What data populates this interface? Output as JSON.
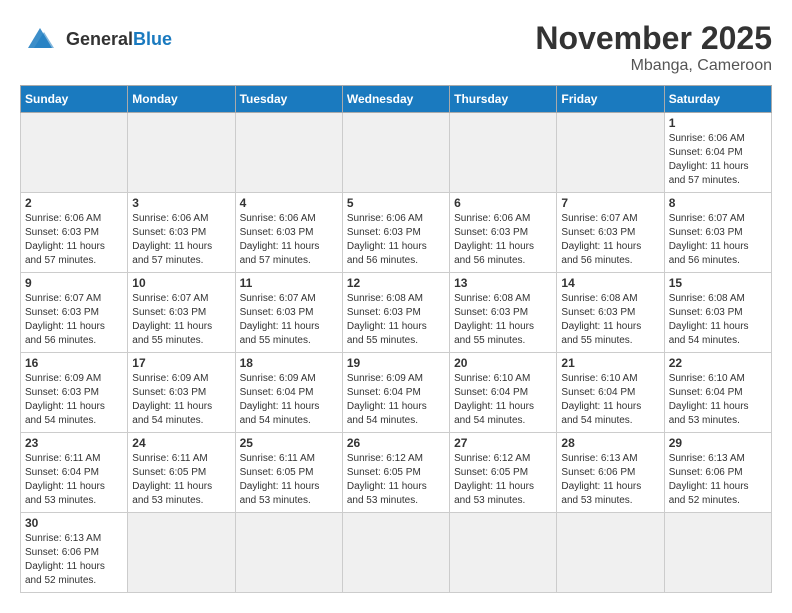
{
  "header": {
    "logo_general": "General",
    "logo_blue": "Blue",
    "month_title": "November 2025",
    "location": "Mbanga, Cameroon"
  },
  "weekdays": [
    "Sunday",
    "Monday",
    "Tuesday",
    "Wednesday",
    "Thursday",
    "Friday",
    "Saturday"
  ],
  "weeks": [
    [
      {
        "day": "",
        "info": ""
      },
      {
        "day": "",
        "info": ""
      },
      {
        "day": "",
        "info": ""
      },
      {
        "day": "",
        "info": ""
      },
      {
        "day": "",
        "info": ""
      },
      {
        "day": "",
        "info": ""
      },
      {
        "day": "1",
        "info": "Sunrise: 6:06 AM\nSunset: 6:04 PM\nDaylight: 11 hours\nand 57 minutes."
      }
    ],
    [
      {
        "day": "2",
        "info": "Sunrise: 6:06 AM\nSunset: 6:03 PM\nDaylight: 11 hours\nand 57 minutes."
      },
      {
        "day": "3",
        "info": "Sunrise: 6:06 AM\nSunset: 6:03 PM\nDaylight: 11 hours\nand 57 minutes."
      },
      {
        "day": "4",
        "info": "Sunrise: 6:06 AM\nSunset: 6:03 PM\nDaylight: 11 hours\nand 57 minutes."
      },
      {
        "day": "5",
        "info": "Sunrise: 6:06 AM\nSunset: 6:03 PM\nDaylight: 11 hours\nand 56 minutes."
      },
      {
        "day": "6",
        "info": "Sunrise: 6:06 AM\nSunset: 6:03 PM\nDaylight: 11 hours\nand 56 minutes."
      },
      {
        "day": "7",
        "info": "Sunrise: 6:07 AM\nSunset: 6:03 PM\nDaylight: 11 hours\nand 56 minutes."
      },
      {
        "day": "8",
        "info": "Sunrise: 6:07 AM\nSunset: 6:03 PM\nDaylight: 11 hours\nand 56 minutes."
      }
    ],
    [
      {
        "day": "9",
        "info": "Sunrise: 6:07 AM\nSunset: 6:03 PM\nDaylight: 11 hours\nand 56 minutes."
      },
      {
        "day": "10",
        "info": "Sunrise: 6:07 AM\nSunset: 6:03 PM\nDaylight: 11 hours\nand 55 minutes."
      },
      {
        "day": "11",
        "info": "Sunrise: 6:07 AM\nSunset: 6:03 PM\nDaylight: 11 hours\nand 55 minutes."
      },
      {
        "day": "12",
        "info": "Sunrise: 6:08 AM\nSunset: 6:03 PM\nDaylight: 11 hours\nand 55 minutes."
      },
      {
        "day": "13",
        "info": "Sunrise: 6:08 AM\nSunset: 6:03 PM\nDaylight: 11 hours\nand 55 minutes."
      },
      {
        "day": "14",
        "info": "Sunrise: 6:08 AM\nSunset: 6:03 PM\nDaylight: 11 hours\nand 55 minutes."
      },
      {
        "day": "15",
        "info": "Sunrise: 6:08 AM\nSunset: 6:03 PM\nDaylight: 11 hours\nand 54 minutes."
      }
    ],
    [
      {
        "day": "16",
        "info": "Sunrise: 6:09 AM\nSunset: 6:03 PM\nDaylight: 11 hours\nand 54 minutes."
      },
      {
        "day": "17",
        "info": "Sunrise: 6:09 AM\nSunset: 6:03 PM\nDaylight: 11 hours\nand 54 minutes."
      },
      {
        "day": "18",
        "info": "Sunrise: 6:09 AM\nSunset: 6:04 PM\nDaylight: 11 hours\nand 54 minutes."
      },
      {
        "day": "19",
        "info": "Sunrise: 6:09 AM\nSunset: 6:04 PM\nDaylight: 11 hours\nand 54 minutes."
      },
      {
        "day": "20",
        "info": "Sunrise: 6:10 AM\nSunset: 6:04 PM\nDaylight: 11 hours\nand 54 minutes."
      },
      {
        "day": "21",
        "info": "Sunrise: 6:10 AM\nSunset: 6:04 PM\nDaylight: 11 hours\nand 54 minutes."
      },
      {
        "day": "22",
        "info": "Sunrise: 6:10 AM\nSunset: 6:04 PM\nDaylight: 11 hours\nand 53 minutes."
      }
    ],
    [
      {
        "day": "23",
        "info": "Sunrise: 6:11 AM\nSunset: 6:04 PM\nDaylight: 11 hours\nand 53 minutes."
      },
      {
        "day": "24",
        "info": "Sunrise: 6:11 AM\nSunset: 6:05 PM\nDaylight: 11 hours\nand 53 minutes."
      },
      {
        "day": "25",
        "info": "Sunrise: 6:11 AM\nSunset: 6:05 PM\nDaylight: 11 hours\nand 53 minutes."
      },
      {
        "day": "26",
        "info": "Sunrise: 6:12 AM\nSunset: 6:05 PM\nDaylight: 11 hours\nand 53 minutes."
      },
      {
        "day": "27",
        "info": "Sunrise: 6:12 AM\nSunset: 6:05 PM\nDaylight: 11 hours\nand 53 minutes."
      },
      {
        "day": "28",
        "info": "Sunrise: 6:13 AM\nSunset: 6:06 PM\nDaylight: 11 hours\nand 53 minutes."
      },
      {
        "day": "29",
        "info": "Sunrise: 6:13 AM\nSunset: 6:06 PM\nDaylight: 11 hours\nand 52 minutes."
      }
    ],
    [
      {
        "day": "30",
        "info": "Sunrise: 6:13 AM\nSunset: 6:06 PM\nDaylight: 11 hours\nand 52 minutes."
      },
      {
        "day": "",
        "info": ""
      },
      {
        "day": "",
        "info": ""
      },
      {
        "day": "",
        "info": ""
      },
      {
        "day": "",
        "info": ""
      },
      {
        "day": "",
        "info": ""
      },
      {
        "day": "",
        "info": ""
      }
    ]
  ]
}
